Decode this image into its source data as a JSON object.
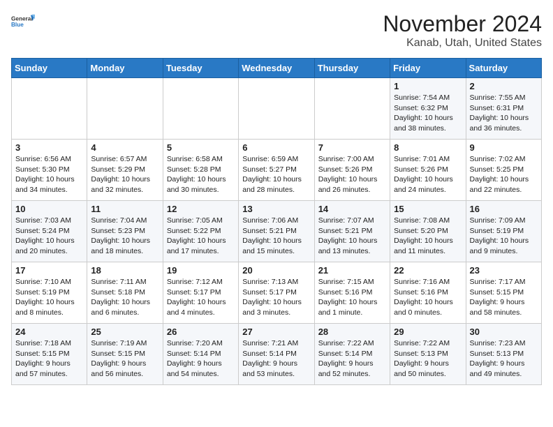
{
  "header": {
    "logo_line1": "General",
    "logo_line2": "Blue",
    "month": "November 2024",
    "location": "Kanab, Utah, United States"
  },
  "weekdays": [
    "Sunday",
    "Monday",
    "Tuesday",
    "Wednesday",
    "Thursday",
    "Friday",
    "Saturday"
  ],
  "weeks": [
    [
      {
        "day": "",
        "info": ""
      },
      {
        "day": "",
        "info": ""
      },
      {
        "day": "",
        "info": ""
      },
      {
        "day": "",
        "info": ""
      },
      {
        "day": "",
        "info": ""
      },
      {
        "day": "1",
        "info": "Sunrise: 7:54 AM\nSunset: 6:32 PM\nDaylight: 10 hours\nand 38 minutes."
      },
      {
        "day": "2",
        "info": "Sunrise: 7:55 AM\nSunset: 6:31 PM\nDaylight: 10 hours\nand 36 minutes."
      }
    ],
    [
      {
        "day": "3",
        "info": "Sunrise: 6:56 AM\nSunset: 5:30 PM\nDaylight: 10 hours\nand 34 minutes."
      },
      {
        "day": "4",
        "info": "Sunrise: 6:57 AM\nSunset: 5:29 PM\nDaylight: 10 hours\nand 32 minutes."
      },
      {
        "day": "5",
        "info": "Sunrise: 6:58 AM\nSunset: 5:28 PM\nDaylight: 10 hours\nand 30 minutes."
      },
      {
        "day": "6",
        "info": "Sunrise: 6:59 AM\nSunset: 5:27 PM\nDaylight: 10 hours\nand 28 minutes."
      },
      {
        "day": "7",
        "info": "Sunrise: 7:00 AM\nSunset: 5:26 PM\nDaylight: 10 hours\nand 26 minutes."
      },
      {
        "day": "8",
        "info": "Sunrise: 7:01 AM\nSunset: 5:26 PM\nDaylight: 10 hours\nand 24 minutes."
      },
      {
        "day": "9",
        "info": "Sunrise: 7:02 AM\nSunset: 5:25 PM\nDaylight: 10 hours\nand 22 minutes."
      }
    ],
    [
      {
        "day": "10",
        "info": "Sunrise: 7:03 AM\nSunset: 5:24 PM\nDaylight: 10 hours\nand 20 minutes."
      },
      {
        "day": "11",
        "info": "Sunrise: 7:04 AM\nSunset: 5:23 PM\nDaylight: 10 hours\nand 18 minutes."
      },
      {
        "day": "12",
        "info": "Sunrise: 7:05 AM\nSunset: 5:22 PM\nDaylight: 10 hours\nand 17 minutes."
      },
      {
        "day": "13",
        "info": "Sunrise: 7:06 AM\nSunset: 5:21 PM\nDaylight: 10 hours\nand 15 minutes."
      },
      {
        "day": "14",
        "info": "Sunrise: 7:07 AM\nSunset: 5:21 PM\nDaylight: 10 hours\nand 13 minutes."
      },
      {
        "day": "15",
        "info": "Sunrise: 7:08 AM\nSunset: 5:20 PM\nDaylight: 10 hours\nand 11 minutes."
      },
      {
        "day": "16",
        "info": "Sunrise: 7:09 AM\nSunset: 5:19 PM\nDaylight: 10 hours\nand 9 minutes."
      }
    ],
    [
      {
        "day": "17",
        "info": "Sunrise: 7:10 AM\nSunset: 5:19 PM\nDaylight: 10 hours\nand 8 minutes."
      },
      {
        "day": "18",
        "info": "Sunrise: 7:11 AM\nSunset: 5:18 PM\nDaylight: 10 hours\nand 6 minutes."
      },
      {
        "day": "19",
        "info": "Sunrise: 7:12 AM\nSunset: 5:17 PM\nDaylight: 10 hours\nand 4 minutes."
      },
      {
        "day": "20",
        "info": "Sunrise: 7:13 AM\nSunset: 5:17 PM\nDaylight: 10 hours\nand 3 minutes."
      },
      {
        "day": "21",
        "info": "Sunrise: 7:15 AM\nSunset: 5:16 PM\nDaylight: 10 hours\nand 1 minute."
      },
      {
        "day": "22",
        "info": "Sunrise: 7:16 AM\nSunset: 5:16 PM\nDaylight: 10 hours\nand 0 minutes."
      },
      {
        "day": "23",
        "info": "Sunrise: 7:17 AM\nSunset: 5:15 PM\nDaylight: 9 hours\nand 58 minutes."
      }
    ],
    [
      {
        "day": "24",
        "info": "Sunrise: 7:18 AM\nSunset: 5:15 PM\nDaylight: 9 hours\nand 57 minutes."
      },
      {
        "day": "25",
        "info": "Sunrise: 7:19 AM\nSunset: 5:15 PM\nDaylight: 9 hours\nand 56 minutes."
      },
      {
        "day": "26",
        "info": "Sunrise: 7:20 AM\nSunset: 5:14 PM\nDaylight: 9 hours\nand 54 minutes."
      },
      {
        "day": "27",
        "info": "Sunrise: 7:21 AM\nSunset: 5:14 PM\nDaylight: 9 hours\nand 53 minutes."
      },
      {
        "day": "28",
        "info": "Sunrise: 7:22 AM\nSunset: 5:14 PM\nDaylight: 9 hours\nand 52 minutes."
      },
      {
        "day": "29",
        "info": "Sunrise: 7:22 AM\nSunset: 5:13 PM\nDaylight: 9 hours\nand 50 minutes."
      },
      {
        "day": "30",
        "info": "Sunrise: 7:23 AM\nSunset: 5:13 PM\nDaylight: 9 hours\nand 49 minutes."
      }
    ]
  ]
}
